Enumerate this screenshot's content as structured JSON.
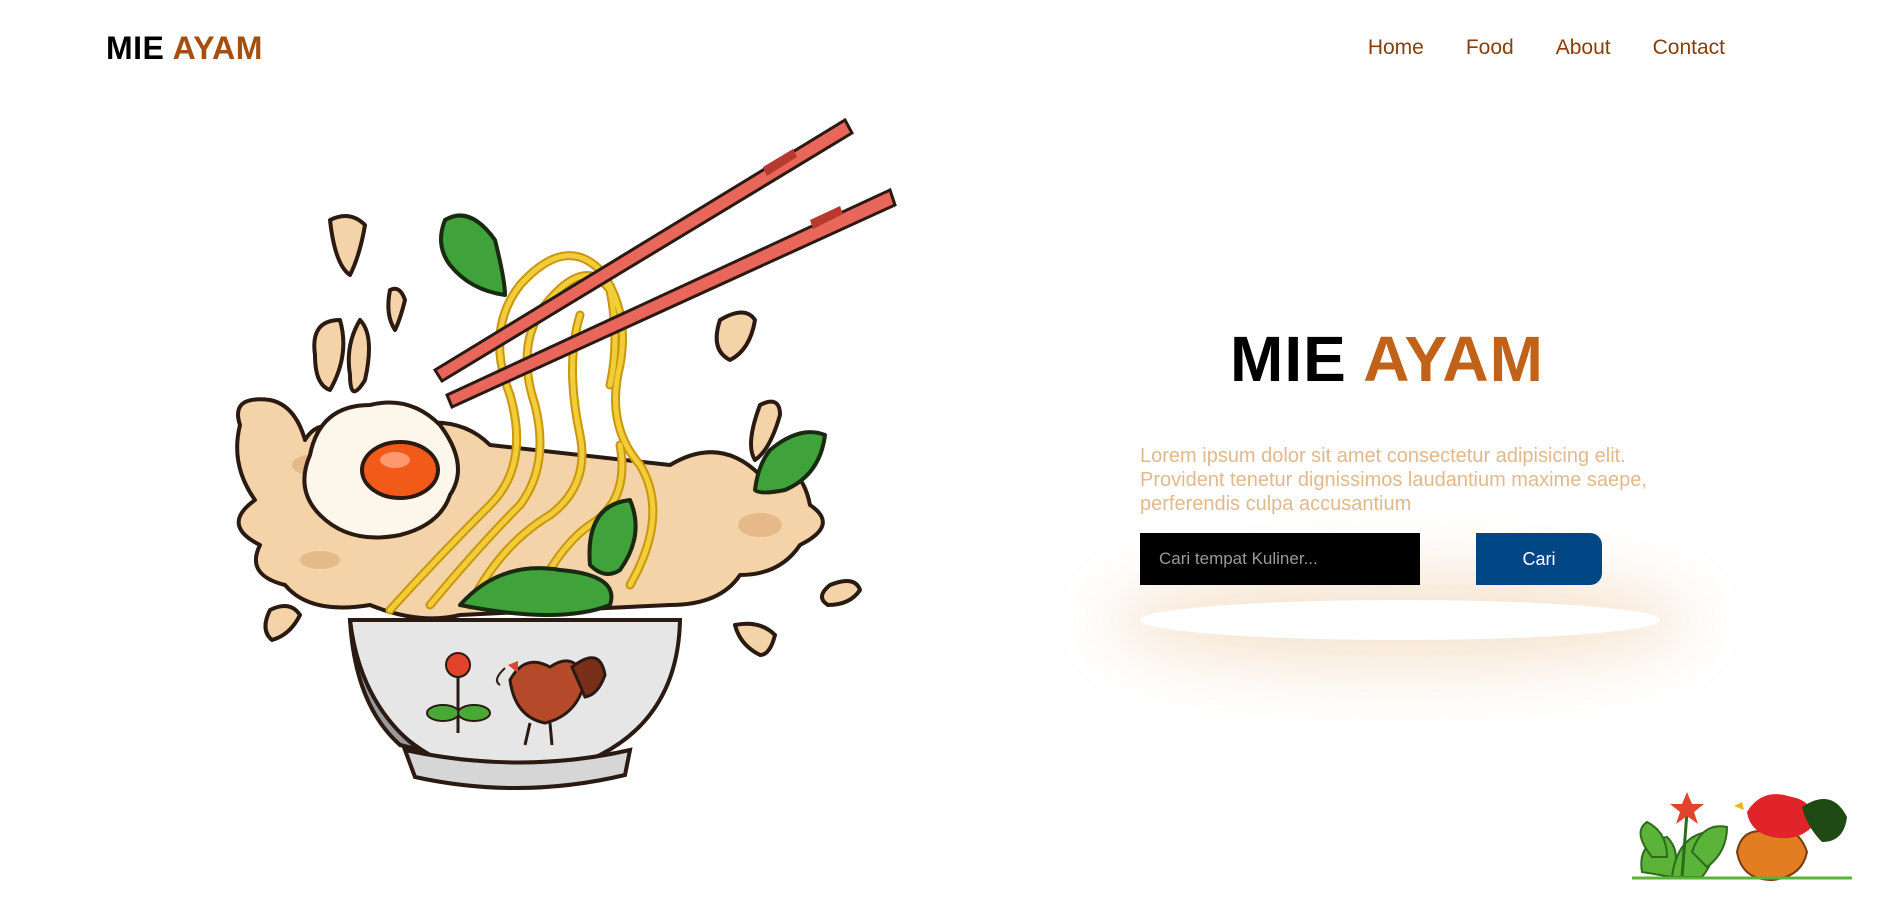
{
  "brand": {
    "word1": "MIE",
    "word2": "AYAM"
  },
  "nav": {
    "items": [
      "Home",
      "Food",
      "About",
      "Contact"
    ]
  },
  "hero": {
    "title_word1": "MIE",
    "title_word2": "AYAM",
    "description": "Lorem ipsum dolor sit amet consectetur adipisicing elit. Provident tenetur dignissimos laudantium maxime saepe, perferendis culpa accusantium"
  },
  "search": {
    "placeholder": "Cari tempat Kuliner...",
    "button_label": "Cari"
  },
  "icons": {
    "hero": "noodle-bowl-illustration",
    "corner": "rooster-plant-illustration"
  },
  "colors": {
    "brand_accent": "#a64d0f",
    "title_accent": "#c0621a",
    "nav_link": "#8a3d07",
    "description_text": "#e2b98c",
    "search_input_bg": "#000000",
    "search_button_bg": "#004584"
  }
}
